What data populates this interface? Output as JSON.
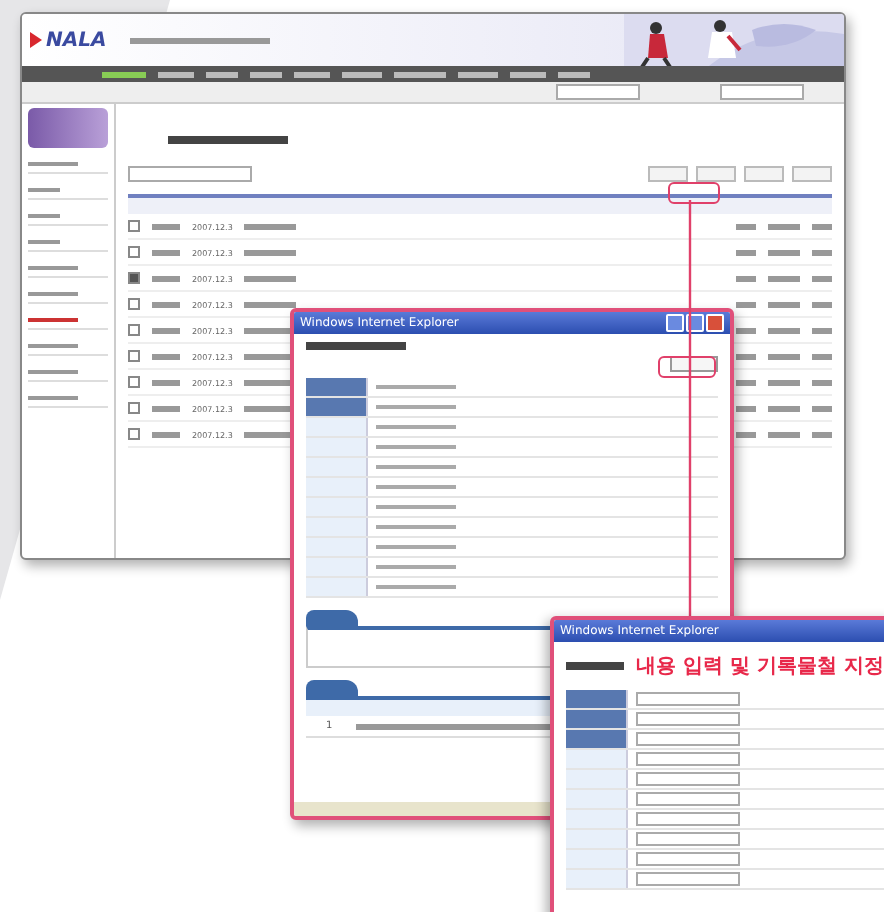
{
  "main_window": {
    "logo": "NALA",
    "nav": [
      {
        "selected": true
      },
      {
        "selected": false
      },
      {
        "selected": false
      },
      {
        "selected": false
      },
      {
        "selected": false
      },
      {
        "selected": false
      },
      {
        "selected": false
      },
      {
        "selected": false
      },
      {
        "selected": false
      },
      {
        "selected": false
      }
    ],
    "rows": [
      {
        "date": "2007.12.3",
        "checked": false
      },
      {
        "date": "2007.12.3",
        "checked": false
      },
      {
        "date": "2007.12.3",
        "checked": true
      },
      {
        "date": "2007.12.3",
        "checked": false
      },
      {
        "date": "2007.12.3",
        "checked": false
      },
      {
        "date": "2007.12.3",
        "checked": false
      },
      {
        "date": "2007.12.3",
        "checked": false
      },
      {
        "date": "2007.12.3",
        "checked": false
      },
      {
        "date": "2007.12.3",
        "checked": false
      }
    ]
  },
  "detail_popup": {
    "title": "Windows Internet Explorer",
    "row_number": "1"
  },
  "register_popup": {
    "title": "Windows Internet Explorer",
    "annotation": "내용 입력 및 기록물철 지정"
  }
}
